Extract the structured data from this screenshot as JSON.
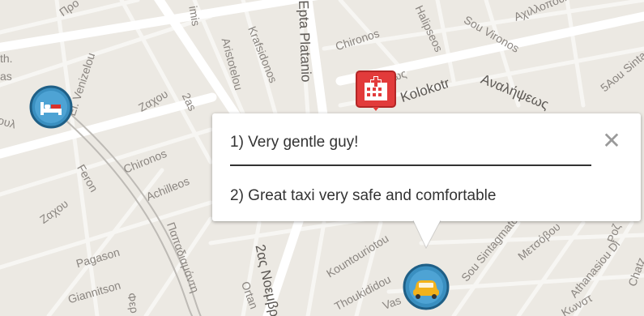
{
  "map": {
    "street_labels": [
      "Προ",
      "El. Venizelou",
      "Ζαχου",
      "2as",
      "imis",
      "Aristotelou",
      "Krafsidonos",
      "Epta Platanio",
      "Chironos",
      "Αχιλλέως",
      "Kolokotr",
      "Halipseos",
      "Αχιλλοπουλου",
      "Sou Vironos",
      "Αναλήψεως",
      "5Aou Sinta",
      "Chironos",
      "Achilleos",
      "Feron",
      "Ζαχου",
      "Pagason",
      "Giannitson",
      "Παπαδιαμάντη",
      "Kountouriotou",
      "2ας Νοεμβρί",
      "Thoukididou",
      "Ortan",
      "Vas",
      "Sou Sintagmatos",
      "Athanasiou Di",
      "Μετσόβου",
      "Ροζ",
      "Κωνστ",
      "Chatz",
      "Φερ",
      "th.",
      "as",
      "ουλ"
    ],
    "markers": {
      "hotel": {
        "icon": "bed-icon",
        "color": "#3a8fc0"
      },
      "hospital": {
        "icon": "hospital-icon",
        "color": "#e23b3b"
      },
      "taxi": {
        "icon": "taxi-icon",
        "color": "#3a8fc0"
      }
    }
  },
  "popup": {
    "reviews": [
      "1) Very gentle guy!",
      "2) Great taxi very safe and comfortable"
    ],
    "close_label": "✕"
  },
  "colors": {
    "map_background": "#ece9e3",
    "major_road": "#ffffff",
    "railway": "#bdbab5",
    "text": "#333333"
  }
}
